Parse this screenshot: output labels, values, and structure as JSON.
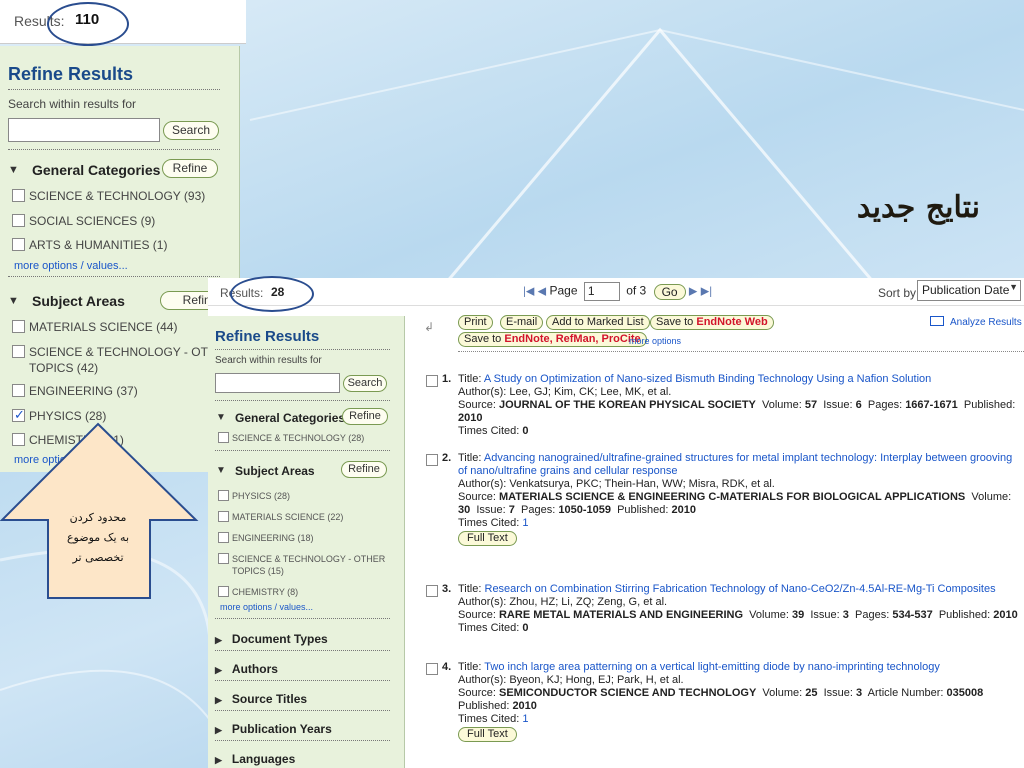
{
  "slide": {
    "title_fa": "نتایج جدید",
    "callout_fa": [
      "محدود کردن",
      "به یک موضوع",
      "تخصصی تر"
    ]
  },
  "back": {
    "results_label": "Results:",
    "results_count": "110",
    "refine_title": "Refine Results",
    "search_within": "Search within results for",
    "search_button": "Search",
    "general_categories": {
      "label": "General Categories",
      "refine_button": "Refine",
      "items": [
        {
          "label": "SCIENCE & TECHNOLOGY (93)",
          "checked": false
        },
        {
          "label": "SOCIAL SCIENCES (9)",
          "checked": false
        },
        {
          "label": "ARTS & HUMANITIES (1)",
          "checked": false
        }
      ],
      "more": "more options / values..."
    },
    "subject_areas": {
      "label": "Subject Areas",
      "refine_button": "Refine",
      "items": [
        {
          "label": "MATERIALS SCIENCE (44)",
          "checked": false
        },
        {
          "label": "SCIENCE & TECHNOLOGY - OTHER",
          "label2": "TOPICS (42)",
          "checked": false
        },
        {
          "label": "ENGINEERING (37)",
          "checked": false
        },
        {
          "label": "PHYSICS (28)",
          "checked": true
        },
        {
          "label": "CHEMISTRY (21)",
          "checked": false
        }
      ],
      "more": "more options / values..."
    }
  },
  "front": {
    "results_label": "Results:",
    "results_count": "28",
    "pager": {
      "page_label": "Page",
      "page_value": "1",
      "of_label": "of 3",
      "go": "Go"
    },
    "sort_label": "Sort by:",
    "sort_value": "Publication Date",
    "refine_title": "Refine Results",
    "search_within": "Search within results for",
    "search_button": "Search",
    "general_categories": {
      "label": "General Categories",
      "refine_button": "Refine",
      "items": [
        {
          "label": "SCIENCE & TECHNOLOGY (28)"
        }
      ]
    },
    "subject_areas": {
      "label": "Subject Areas",
      "refine_button": "Refine",
      "items": [
        {
          "label": "PHYSICS (28)"
        },
        {
          "label": "MATERIALS SCIENCE (22)"
        },
        {
          "label": "ENGINEERING (18)"
        },
        {
          "label": "SCIENCE & TECHNOLOGY - OTHER",
          "label2": "TOPICS (15)"
        },
        {
          "label": "CHEMISTRY (8)"
        }
      ],
      "more": "more options / values..."
    },
    "collapsed": [
      "Document Types",
      "Authors",
      "Source Titles",
      "Publication Years",
      "Languages"
    ],
    "toolbar": {
      "print": "Print",
      "email": "E-mail",
      "add_marked": "Add to Marked List",
      "save_to": "Save to",
      "endnote_web": "EndNote Web",
      "save_to2": "Save to",
      "endnote_refman_procite": "EndNote, RefMan, ProCite",
      "more_options": "more options",
      "analyze": "Analyze Results"
    },
    "results": [
      {
        "num": "1.",
        "title_label": "Title:",
        "title": "A Study on Optimization of Nano-sized Bismuth Binding Technology Using a Nafion Solution",
        "authors": "Author(s): Lee, GJ; Kim, CK; Lee, MK, et al.",
        "source_label": "Source:",
        "source": "JOURNAL OF THE KOREAN PHYSICAL SOCIETY",
        "details_1": "Volume:",
        "volume": "57",
        "details_2": "Issue:",
        "issue": "6",
        "details_3": "Pages:",
        "pages": "1667-1671",
        "details_4": "Published:",
        "published": "2010",
        "times_cited_label": "Times Cited:",
        "times_cited": "0",
        "full_text": ""
      },
      {
        "num": "2.",
        "title_label": "Title:",
        "title": "Advancing nanograined/ultrafine-grained structures for metal implant technology: Interplay between grooving of nano/ultrafine grains and cellular response",
        "authors": "Author(s): Venkatsurya, PKC; Thein-Han, WW; Misra, RDK, et al.",
        "source_label": "Source:",
        "source": "MATERIALS SCIENCE & ENGINEERING C-MATERIALS FOR BIOLOGICAL APPLICATIONS",
        "details_1": "Volume:",
        "volume": "30",
        "details_2": "Issue:",
        "issue": "7",
        "details_3": "Pages:",
        "pages": "1050-1059",
        "details_4": "Published:",
        "published": "2010",
        "times_cited_label": "Times Cited:",
        "times_cited": "1",
        "full_text": "Full Text"
      },
      {
        "num": "3.",
        "title_label": "Title:",
        "title": "Research on Combination Stirring Fabrication Technology of Nano-CeO2/Zn-4.5Al-RE-Mg-Ti Composites",
        "authors": "Author(s): Zhou, HZ; Li, ZQ; Zeng, G, et al.",
        "source_label": "Source:",
        "source": "RARE METAL MATERIALS AND ENGINEERING",
        "details_1": "Volume:",
        "volume": "39",
        "details_2": "Issue:",
        "issue": "3",
        "details_3": "Pages:",
        "pages": "534-537",
        "details_4": "Published:",
        "published": "2010",
        "times_cited_label": "Times Cited:",
        "times_cited": "0",
        "full_text": ""
      },
      {
        "num": "4.",
        "title_label": "Title:",
        "title": "Two inch large area patterning on a vertical light-emitting diode by nano-imprinting technology",
        "authors": "Author(s): Byeon, KJ; Hong, EJ; Park, H, et al.",
        "source_label": "Source:",
        "source": "SEMICONDUCTOR SCIENCE AND TECHNOLOGY",
        "details_1": "Volume:",
        "volume": "25",
        "details_2": "Issue:",
        "issue": "3",
        "details_3": "Article Number:",
        "pages": "035008",
        "details_4": "Published:",
        "published": "2010",
        "times_cited_label": "Times Cited:",
        "times_cited": "1",
        "full_text": "Full Text"
      }
    ]
  }
}
